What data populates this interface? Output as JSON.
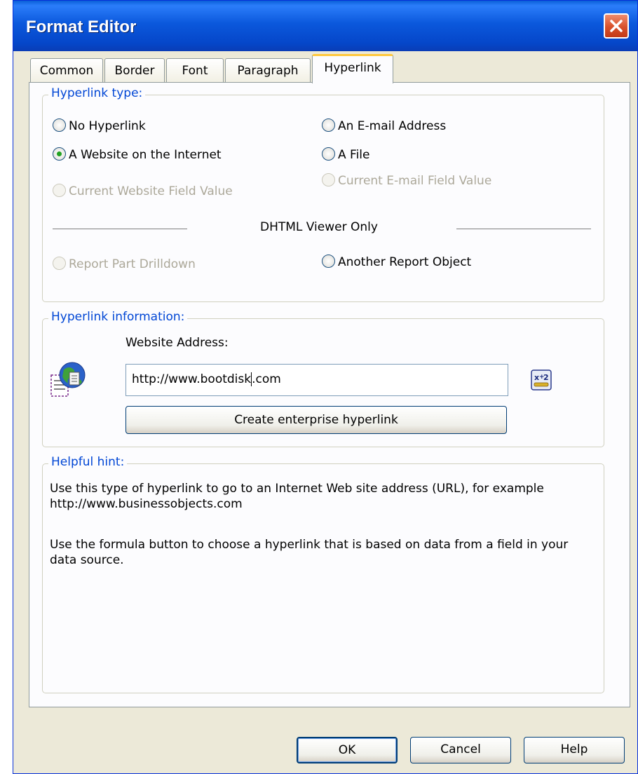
{
  "window": {
    "title": "Format Editor"
  },
  "tabs": [
    {
      "label": "Common"
    },
    {
      "label": "Border"
    },
    {
      "label": "Font"
    },
    {
      "label": "Paragraph"
    },
    {
      "label": "Hyperlink",
      "active": true
    }
  ],
  "hyperlink_type": {
    "title": "Hyperlink type:",
    "no_hyperlink": "No Hyperlink",
    "website": "A Website on the Internet",
    "current_website": "Current Website Field Value",
    "email": "An E-mail Address",
    "file": "A File",
    "current_email": "Current E-mail Field Value",
    "dhtml_label": "DHTML Viewer Only",
    "report_part": "Report Part Drilldown",
    "another_object": "Another Report Object",
    "selected": "website"
  },
  "hyperlink_info": {
    "title": "Hyperlink information:",
    "address_label": "Website Address:",
    "address_before_caret": "http://www.bootdisk",
    "address_after_caret": ".com",
    "enterprise_button": "Create enterprise hyperlink",
    "formula_icon": "formula-x2-icon",
    "hyperlink_icon": "globe-document-icon"
  },
  "hint": {
    "title": "Helpful hint:",
    "line1": "Use this type of hyperlink to go to an Internet Web site address (URL), for example http://www.businessobjects.com",
    "line2": "Use the formula button to choose a hyperlink that is based on data from a field in your data source."
  },
  "buttons": {
    "ok": "OK",
    "cancel": "Cancel",
    "help": "Help"
  },
  "colors": {
    "titlebar": "#0a58dc",
    "group_title": "#0046d5",
    "dialog_bg": "#ece9d8",
    "active_tab_accent": "#ffc83c"
  }
}
